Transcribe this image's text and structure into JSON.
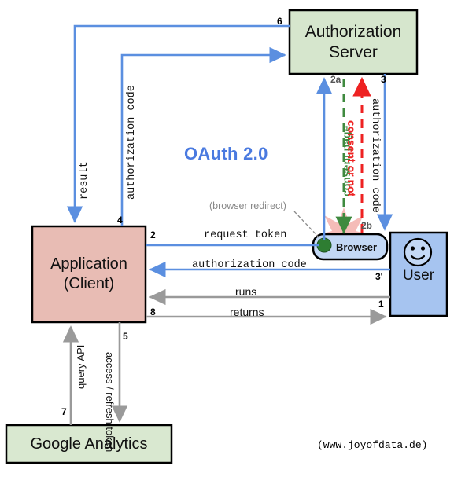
{
  "title": "OAuth 2.0",
  "watermark": "(www.joyofdata.de)",
  "annotation": "(browser redirect)",
  "colors": {
    "blue_arrow": "#5b8fe0",
    "gray_arrow": "#9a9a9a",
    "green_dashed": "#3f8a3f",
    "red_dashed": "#ee2222",
    "server_fill": "#d6e6cd",
    "app_fill": "#e8bcb4",
    "user_fill": "#a6c4f0",
    "browser_fill": "#c3d8f5",
    "analytics_fill": "#d9e8d0",
    "title_blue": "#4a7ae0",
    "annotation_gray": "#888888",
    "browser_dot": "#2e7d32",
    "starburst": "#f2a6a0"
  },
  "nodes": {
    "authorization_server": {
      "line1": "Authorization",
      "line2": "Server"
    },
    "application": {
      "line1": "Application",
      "line2": "(Client)"
    },
    "user": {
      "label": "User",
      "icon": "smiley-face-icon"
    },
    "browser": {
      "label": "Browser",
      "icon": "green-dot-icon"
    },
    "google_analytics": {
      "label": "Google Analytics"
    }
  },
  "edges": [
    {
      "id": "e1",
      "num": "1",
      "label": "runs",
      "orientation": "horizontal",
      "style": "gray"
    },
    {
      "id": "e2",
      "num": "2",
      "label": "request token",
      "orientation": "horizontal",
      "style": "blue"
    },
    {
      "id": "e2a",
      "num": "2a",
      "label": "consent page",
      "orientation": "vertical",
      "style": "green-dashed"
    },
    {
      "id": "e2b",
      "num": "2b",
      "label": "consent or not",
      "orientation": "vertical",
      "style": "red-dashed"
    },
    {
      "id": "e3",
      "num": "3",
      "label": "authorization code",
      "orientation": "vertical",
      "style": "blue"
    },
    {
      "id": "e3p",
      "num": "3'",
      "label": "authorization code",
      "orientation": "horizontal",
      "style": "blue"
    },
    {
      "id": "e4",
      "num": "4",
      "label": "authorization code",
      "orientation": "vertical",
      "style": "blue"
    },
    {
      "id": "e5",
      "num": "5",
      "label": "access / refresh token",
      "orientation": "vertical",
      "style": "blue"
    },
    {
      "id": "e6",
      "num": "6",
      "label": "result",
      "orientation": "vertical",
      "style": "gray"
    },
    {
      "id": "e7",
      "num": "7",
      "label": "query API",
      "orientation": "vertical",
      "style": "gray"
    },
    {
      "id": "e8",
      "num": "8",
      "label": "returns",
      "orientation": "horizontal",
      "style": "gray"
    }
  ]
}
